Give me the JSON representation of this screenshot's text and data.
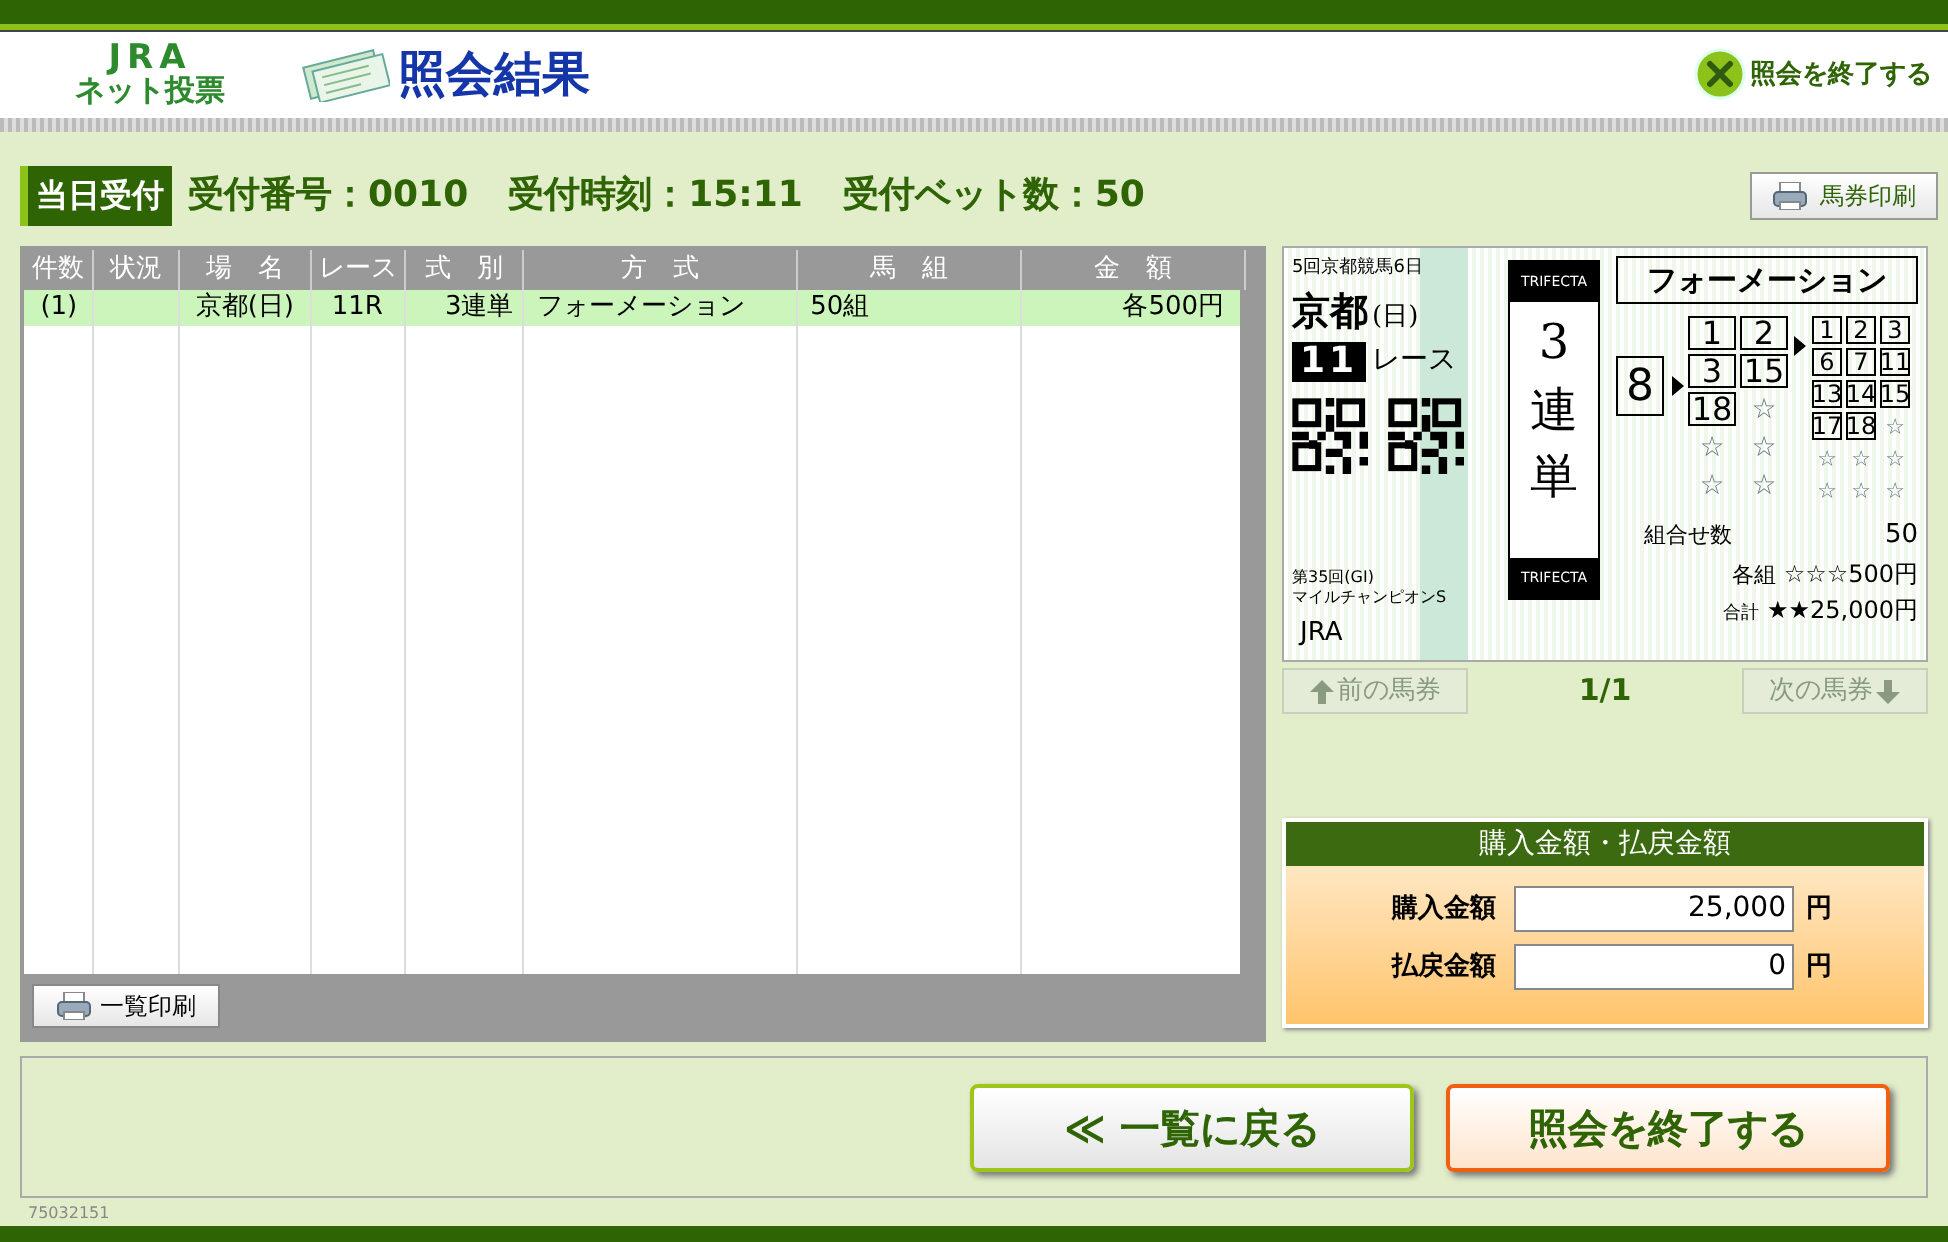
{
  "header": {
    "logo_top": "JRA",
    "logo_bottom": "ネット投票",
    "title": "照会結果",
    "exit_link": "照会を終了する"
  },
  "info": {
    "badge": "当日受付",
    "receipt_no": "受付番号：0010",
    "receipt_time": "受付時刻：15:11",
    "bet_count": "受付ベット数：50",
    "print_ticket": "馬券印刷"
  },
  "table": {
    "columns": [
      "件数",
      "状況",
      "場　名",
      "レース",
      "式　別",
      "方　式",
      "馬　組",
      "金　額"
    ],
    "rows": [
      {
        "selected": true,
        "cells": [
          "(1)",
          "",
          "京都(日)",
          "11R",
          "3連単",
          "フォーメーション",
          "50組",
          "各500円"
        ]
      }
    ],
    "print_list": "一覧印刷"
  },
  "ticket": {
    "meeting": "5回京都競馬6日",
    "venue": "京都",
    "day": "(日)",
    "race_no": "11",
    "race_label": "レース",
    "race_name_1": "第35回(GI)",
    "race_name_2": "マイルチャンピオンS",
    "issuer": "JRA",
    "bet_type_en_top": "TRIFECTA",
    "bet_type": "3連単",
    "bet_type_en_bottom": "TRIFECTA",
    "method": "フォーメーション",
    "first": [
      {
        "kind": "number",
        "text": "8"
      }
    ],
    "second": [
      {
        "kind": "number",
        "text": "1"
      },
      {
        "kind": "number",
        "text": "2"
      },
      {
        "kind": "number",
        "text": "3"
      },
      {
        "kind": "number",
        "text": "15"
      },
      {
        "kind": "number",
        "text": "18"
      },
      {
        "kind": "blank",
        "text": "☆"
      },
      {
        "kind": "blank",
        "text": "☆"
      },
      {
        "kind": "blank",
        "text": "☆"
      },
      {
        "kind": "blank",
        "text": "☆"
      },
      {
        "kind": "blank",
        "text": "☆"
      }
    ],
    "third": [
      {
        "kind": "number",
        "text": "1"
      },
      {
        "kind": "number",
        "text": "2"
      },
      {
        "kind": "number",
        "text": "3"
      },
      {
        "kind": "number",
        "text": "6"
      },
      {
        "kind": "number",
        "text": "7"
      },
      {
        "kind": "number",
        "text": "11"
      },
      {
        "kind": "number",
        "text": "13"
      },
      {
        "kind": "number",
        "text": "14"
      },
      {
        "kind": "number",
        "text": "15"
      },
      {
        "kind": "number",
        "text": "17"
      },
      {
        "kind": "number",
        "text": "18"
      },
      {
        "kind": "blank",
        "text": "☆"
      },
      {
        "kind": "blank",
        "text": "☆"
      },
      {
        "kind": "blank",
        "text": "☆"
      },
      {
        "kind": "blank",
        "text": "☆"
      },
      {
        "kind": "blank",
        "text": "☆"
      },
      {
        "kind": "blank",
        "text": "☆"
      },
      {
        "kind": "blank",
        "text": "☆"
      }
    ],
    "combos_label": "組合せ数",
    "combos": "50",
    "each_label": "各組",
    "each_value": "☆☆☆500円",
    "total_label": "合計",
    "total_value": "★★25,000円"
  },
  "ticket_nav": {
    "prev": "前の馬券",
    "page": "1/1",
    "next": "次の馬券"
  },
  "amounts": {
    "title": "購入金額・払戻金額",
    "rows": [
      {
        "label": "購入金額",
        "value": "25,000",
        "unit": "円"
      },
      {
        "label": "払戻金額",
        "value": "0",
        "unit": "円"
      }
    ]
  },
  "actions": {
    "back": "≪ 一覧に戻る",
    "finish": "照会を終了する"
  },
  "terminal_id": "75032151"
}
